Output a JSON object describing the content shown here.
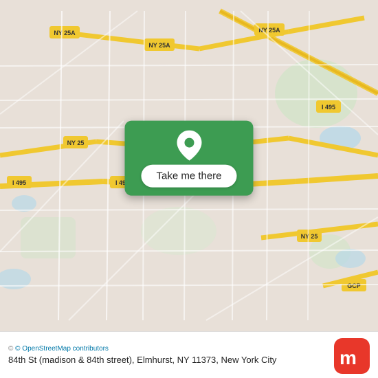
{
  "map": {
    "bg_color": "#e8e0d8",
    "road_color": "#ffffff",
    "highway_color": "#f5c842",
    "water_color": "#a8d4e8",
    "green_color": "#c8dfc8"
  },
  "popup": {
    "button_label": "Take me there",
    "pin_color": "#ffffff"
  },
  "bottom_bar": {
    "attribution": "© OpenStreetMap contributors",
    "address": "84th St (madison & 84th street), Elmhurst, NY 11373, New York City",
    "logo_text": "moovit"
  }
}
